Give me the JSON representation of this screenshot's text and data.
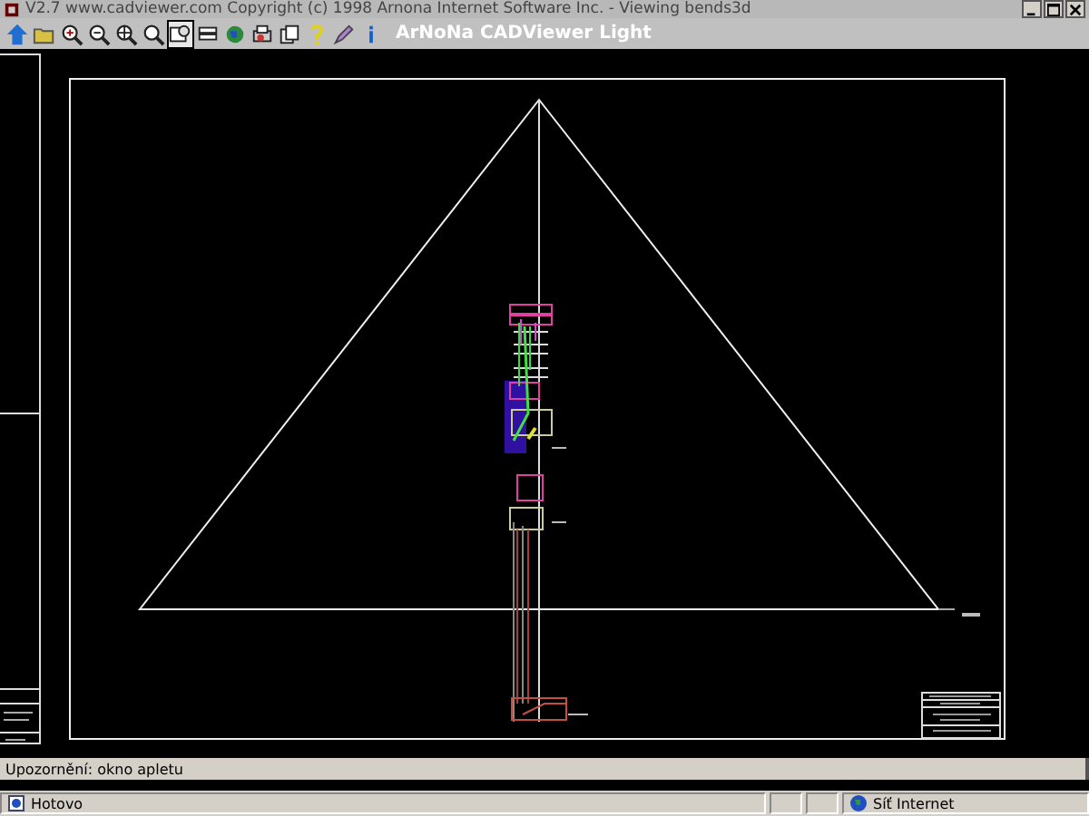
{
  "window": {
    "title": "V2.7 www.cadviewer.com Copyright (c) 1998 Arnona Internet Software Inc. - Viewing bends3d"
  },
  "toolbar": {
    "buttons": [
      {
        "kind": "up",
        "selected": false
      },
      {
        "kind": "open",
        "selected": false
      },
      {
        "kind": "zoom-in",
        "selected": false
      },
      {
        "kind": "zoom-out",
        "selected": false
      },
      {
        "kind": "zoom-extents",
        "selected": false
      },
      {
        "kind": "zoom-previous",
        "selected": false
      },
      {
        "kind": "zoom-window",
        "selected": true
      },
      {
        "kind": "layers",
        "selected": false
      },
      {
        "kind": "globe",
        "selected": false
      },
      {
        "kind": "print",
        "selected": false
      },
      {
        "kind": "copy",
        "selected": false
      },
      {
        "kind": "help",
        "selected": false
      },
      {
        "kind": "pen",
        "selected": false
      },
      {
        "kind": "info",
        "selected": false
      }
    ],
    "app_title": "ArNoNa CADViewer Light"
  },
  "applet_status": "Upozornění: okno apletu",
  "browser_status": {
    "text": "Hotovo",
    "zone": "Síť Internet"
  }
}
